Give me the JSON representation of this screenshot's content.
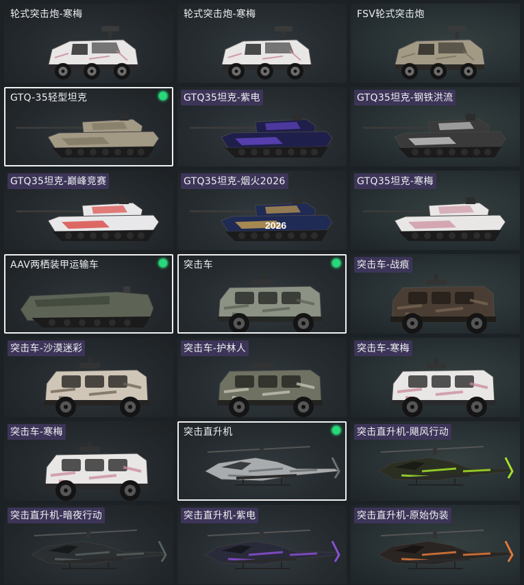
{
  "tiles": [
    {
      "name": "轮式突击炮-寒梅",
      "kind": "ifv",
      "theme": "sakura",
      "selected": false,
      "style": "plain"
    },
    {
      "name": "轮式突击炮-寒梅",
      "kind": "ifv",
      "theme": "sakura",
      "selected": false,
      "style": "plain"
    },
    {
      "name": "FSV轮式突击炮",
      "kind": "ifv",
      "theme": "desert",
      "selected": false,
      "style": "plain"
    },
    {
      "name": "GTQ-35轻型坦克",
      "kind": "tank",
      "theme": "desert",
      "selected": true,
      "style": "plain"
    },
    {
      "name": "GTQ35坦克-紫电",
      "kind": "tank",
      "theme": "purple",
      "selected": false,
      "style": "purple"
    },
    {
      "name": "GTQ35坦克-钢铁洪流",
      "kind": "tank",
      "theme": "steel",
      "selected": false,
      "style": "purple"
    },
    {
      "name": "GTQ35坦克-巅峰竞赛",
      "kind": "tank",
      "theme": "racing",
      "selected": false,
      "style": "purple"
    },
    {
      "name": "GTQ35坦克-烟火2026",
      "kind": "tank",
      "theme": "firework",
      "selected": false,
      "style": "purple",
      "decal": "2026"
    },
    {
      "name": "GTQ35坦克-寒梅",
      "kind": "tank",
      "theme": "sakura",
      "selected": false,
      "style": "purple"
    },
    {
      "name": "AAV两栖装甲运输车",
      "kind": "aav",
      "theme": "green",
      "selected": true,
      "style": "plain"
    },
    {
      "name": "突击车",
      "kind": "mrap",
      "theme": "olive",
      "selected": true,
      "style": "plain"
    },
    {
      "name": "突击车-战痕",
      "kind": "mrap",
      "theme": "rust",
      "selected": false,
      "style": "purple"
    },
    {
      "name": "突击车-沙漠迷彩",
      "kind": "mrap",
      "theme": "sandcamo",
      "selected": false,
      "style": "purple"
    },
    {
      "name": "突击车-护林人",
      "kind": "mrap",
      "theme": "woodcamo",
      "selected": false,
      "style": "purple"
    },
    {
      "name": "突击车-寒梅",
      "kind": "mrap",
      "theme": "sakura",
      "selected": false,
      "style": "purple"
    },
    {
      "name": "突击车-寒梅",
      "kind": "mrap",
      "theme": "sakura",
      "selected": false,
      "style": "purple"
    },
    {
      "name": "突击直升机",
      "kind": "heli",
      "theme": "gray",
      "selected": true,
      "style": "plain"
    },
    {
      "name": "突击直升机-飓风行动",
      "kind": "heli",
      "theme": "toxic",
      "selected": false,
      "style": "purple"
    },
    {
      "name": "突击直升机-暗夜行动",
      "kind": "heli",
      "theme": "night",
      "selected": false,
      "style": "purple"
    },
    {
      "name": "突击直升机-紫电",
      "kind": "heli",
      "theme": "violet",
      "selected": false,
      "style": "purple"
    },
    {
      "name": "突击直升机-原始伪装",
      "kind": "heli",
      "theme": "ember",
      "selected": false,
      "style": "purple"
    }
  ],
  "themes": {
    "sakura": {
      "body": "#e9e6e6",
      "accent": "#c98a9a",
      "dark": "#2a2a2c"
    },
    "desert": {
      "body": "#a39a86",
      "accent": "#7c735f",
      "dark": "#2b2a26"
    },
    "purple": {
      "body": "#1e1f4a",
      "accent": "#6d4bd6",
      "dark": "#121225"
    },
    "steel": {
      "body": "#3a3a3a",
      "accent": "#dcdcdc",
      "dark": "#1c1c1c"
    },
    "racing": {
      "body": "#e8e8ea",
      "accent": "#d8302a",
      "dark": "#2a2a2c"
    },
    "firework": {
      "body": "#1f2a55",
      "accent": "#e0b050",
      "dark": "#151a30"
    },
    "green": {
      "body": "#5d6456",
      "accent": "#3f453a",
      "dark": "#242722"
    },
    "olive": {
      "body": "#8c9284",
      "accent": "#5c6257",
      "dark": "#262826"
    },
    "rust": {
      "body": "#4a3e34",
      "accent": "#7a6654",
      "dark": "#201c18"
    },
    "sandcamo": {
      "body": "#cfc6b8",
      "accent": "#6f6253",
      "dark": "#262422"
    },
    "woodcamo": {
      "body": "#6f7262",
      "accent": "#c9c7b6",
      "dark": "#232420"
    },
    "gray": {
      "body": "#a9acae",
      "accent": "#6e7275",
      "dark": "#2c2f31"
    },
    "toxic": {
      "body": "#2a2f22",
      "accent": "#a4e22c",
      "dark": "#171a13"
    },
    "night": {
      "body": "#2b2f31",
      "accent": "#56605e",
      "dark": "#151718"
    },
    "violet": {
      "body": "#2a2b3a",
      "accent": "#8a4fd6",
      "dark": "#15151e"
    },
    "ember": {
      "body": "#2a2522",
      "accent": "#e07a3a",
      "dark": "#161312"
    }
  }
}
